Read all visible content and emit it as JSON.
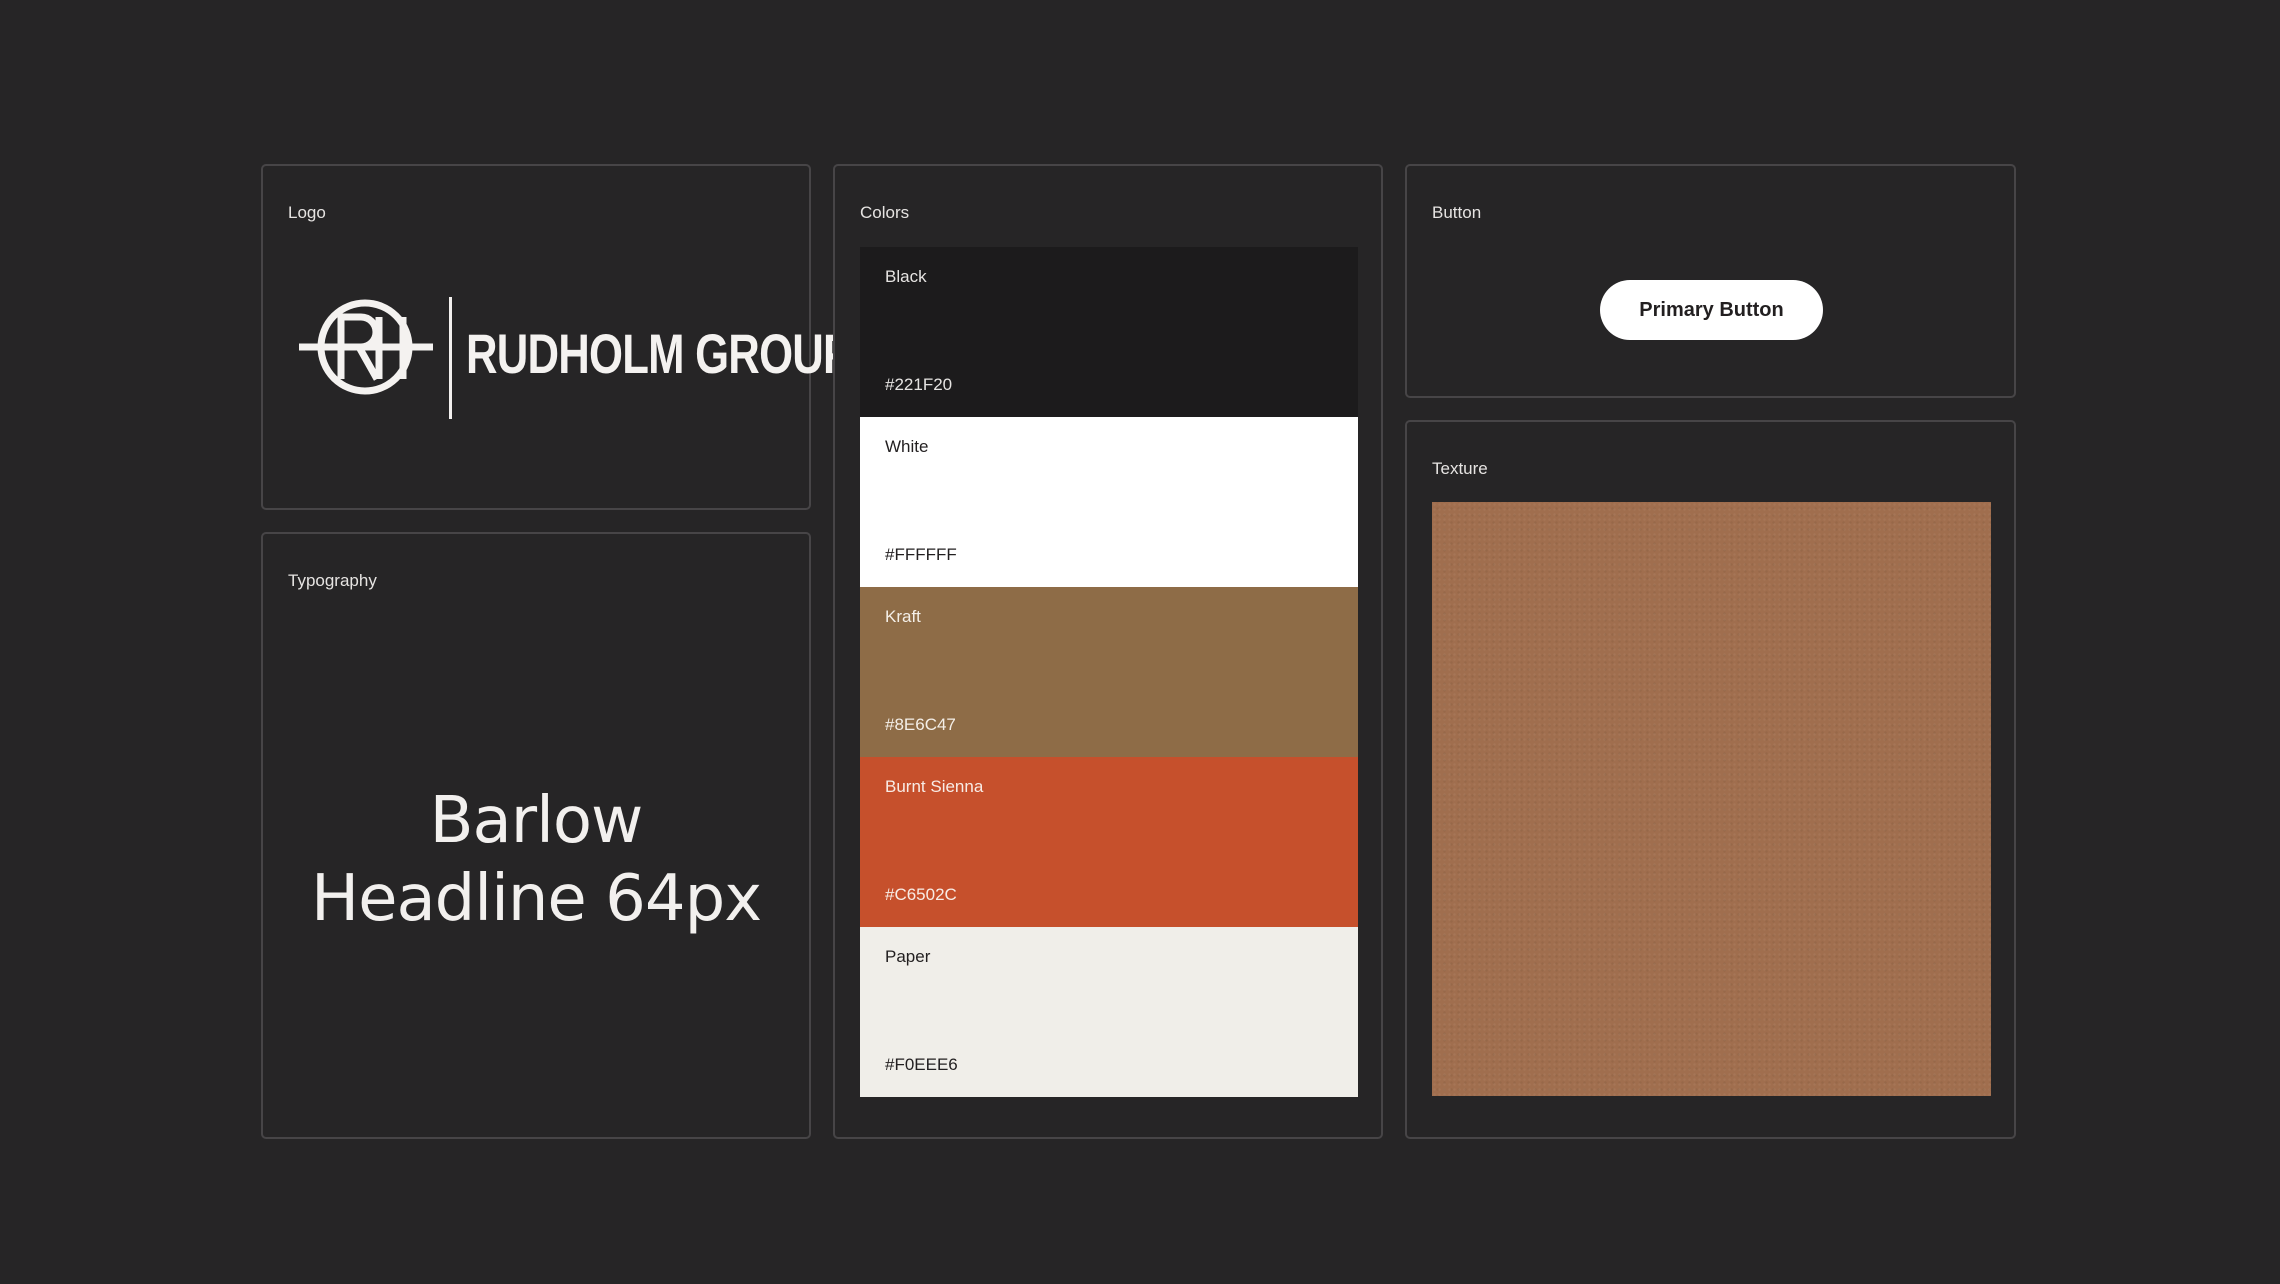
{
  "logo": {
    "label": "Logo",
    "wordmark": "RUDHOLM GROUP",
    "monogram": "RH"
  },
  "typography": {
    "label": "Typography",
    "sample_line1": "Barlow",
    "sample_line2": "Headline 64px"
  },
  "colors": {
    "label": "Colors",
    "swatches": [
      {
        "name": "Black",
        "hex": "#221F20",
        "color": "#1c1b1c",
        "text_color": "#e6e4e2"
      },
      {
        "name": "White",
        "hex": "#FFFFFF",
        "color": "#ffffff",
        "text_color": "#221f20"
      },
      {
        "name": "Kraft",
        "hex": "#8E6C47",
        "color": "#8e6c47",
        "text_color": "#f4efe8"
      },
      {
        "name": "Burnt Sienna",
        "hex": "#C6502C",
        "color": "#c6502c",
        "text_color": "#f8ece6"
      },
      {
        "name": "Paper",
        "hex": "#F0EEE6",
        "color": "#f0eee9",
        "text_color": "#221f20"
      }
    ]
  },
  "button": {
    "label": "Button",
    "primary_label": "Primary Button"
  },
  "texture": {
    "label": "Texture",
    "color": "#a06e4e"
  }
}
